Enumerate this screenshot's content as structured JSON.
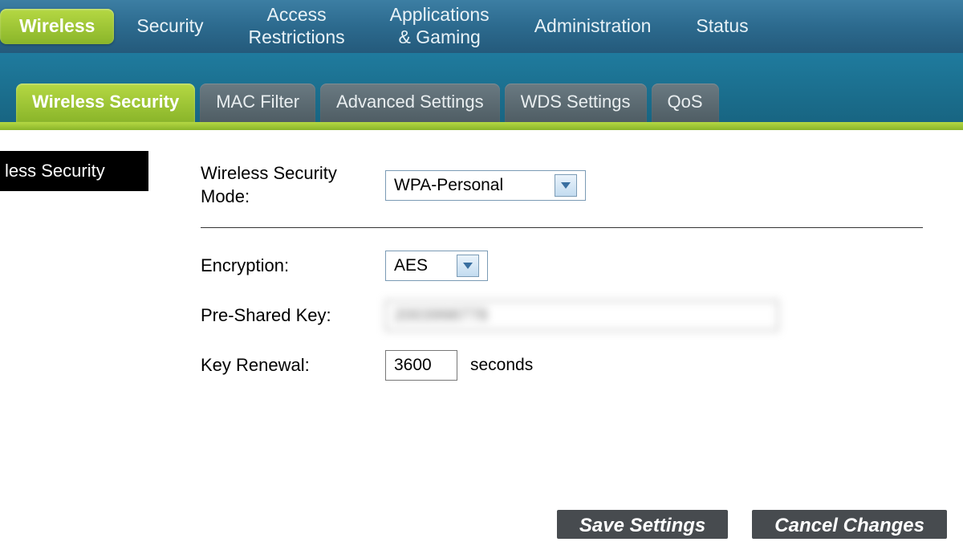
{
  "topnav": {
    "items": [
      {
        "label": "Wireless",
        "active": true
      },
      {
        "label": "Security"
      },
      {
        "label": "Access\nRestrictions"
      },
      {
        "label": "Applications\n& Gaming"
      },
      {
        "label": "Administration"
      },
      {
        "label": "Status"
      }
    ]
  },
  "subnav": {
    "items": [
      {
        "label": "Wireless Security",
        "active": true
      },
      {
        "label": "MAC Filter"
      },
      {
        "label": "Advanced Settings"
      },
      {
        "label": "WDS Settings"
      },
      {
        "label": "QoS"
      }
    ]
  },
  "section": {
    "title": "less Security"
  },
  "form": {
    "mode_label": "Wireless Security Mode:",
    "mode_value": "WPA-Personal",
    "encryption_label": "Encryption:",
    "encryption_value": "AES",
    "psk_label": "Pre-Shared Key:",
    "psk_value": "2003998778",
    "renewal_label": "Key Renewal:",
    "renewal_value": "3600",
    "renewal_suffix": "seconds"
  },
  "buttons": {
    "save": "Save Settings",
    "cancel": "Cancel Changes"
  }
}
